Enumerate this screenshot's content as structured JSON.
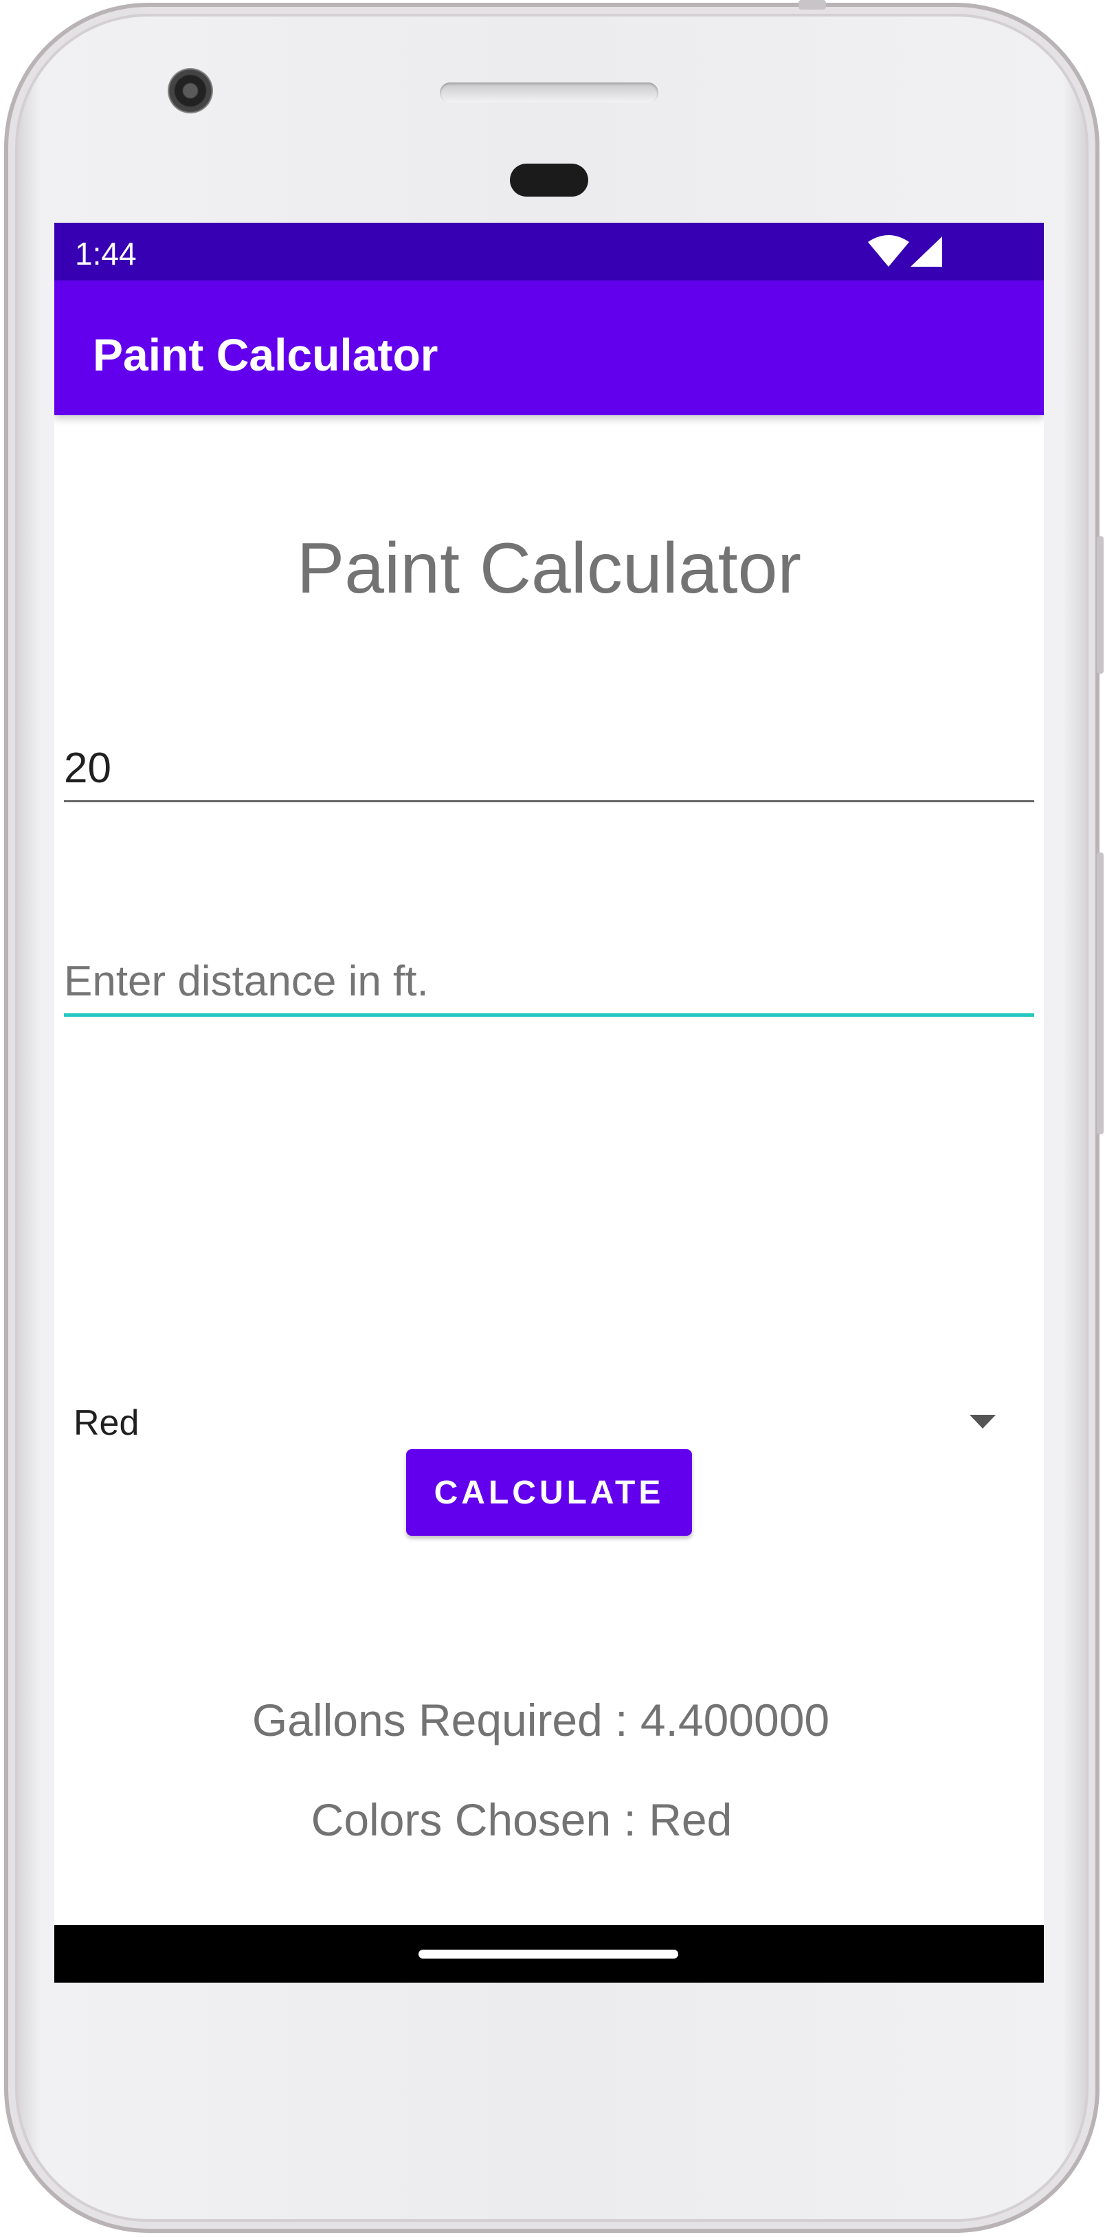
{
  "status_bar": {
    "time": "1:44"
  },
  "app_bar": {
    "title": "Paint Calculator"
  },
  "main": {
    "heading": "Paint Calculator",
    "length_field": {
      "value": "20"
    },
    "distance_field": {
      "placeholder": "Enter distance  in ft."
    },
    "color_spinner": {
      "selected": "Red"
    },
    "calculate_label": "CALCULATE",
    "gallons_text": "Gallons Required : 4.400000",
    "colors_text": "Colors Chosen : Red"
  },
  "colors": {
    "primary": "#6200ee",
    "primary_dark": "#3700b3",
    "accent": "#26c6c0"
  }
}
